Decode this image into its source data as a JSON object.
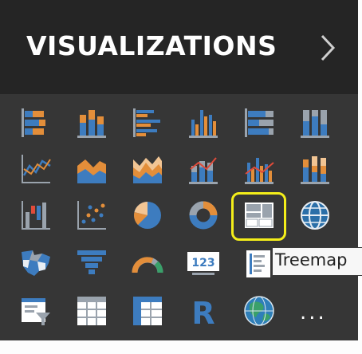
{
  "header": {
    "title": "VISUALIZATIONS",
    "expand_icon": "chevron-right-icon"
  },
  "tooltip": {
    "text": "Treemap"
  },
  "more": {
    "label": "..."
  },
  "highlight_color": "#f4ee1a",
  "colors": {
    "blue": "#3d7cbf",
    "orange": "#e38e3a",
    "gray": "#9aa3ad",
    "tan": "#f2c594"
  },
  "grid_icons": [
    [
      "stacked-bar-chart-icon",
      "stacked-column-chart-icon",
      "clustered-bar-chart-icon",
      "clustered-column-chart-icon",
      "100-percent-stacked-bar-chart-icon",
      "100-percent-stacked-column-chart-icon"
    ],
    [
      "line-chart-icon",
      "area-chart-icon",
      "stacked-area-chart-icon",
      "line-and-stacked-column-chart-icon",
      "line-and-clustered-column-chart-icon",
      "ribbon-chart-icon"
    ],
    [
      "waterfall-chart-icon",
      "scatter-chart-icon",
      "pie-chart-icon",
      "donut-chart-icon",
      "treemap-icon",
      "map-icon"
    ],
    [
      "filled-map-icon",
      "funnel-icon",
      "gauge-icon",
      "card-icon",
      "multi-row-card-icon",
      "slicer-icon"
    ],
    [
      "slicer-filter-icon",
      "table-icon",
      "matrix-icon",
      "r-script-visual-icon",
      "arcgis-map-icon",
      "more-options-icon"
    ]
  ]
}
